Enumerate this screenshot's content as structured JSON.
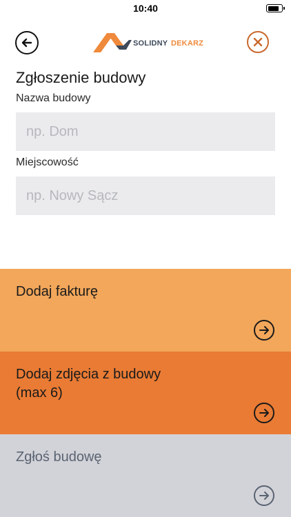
{
  "status_bar": {
    "time": "10:40"
  },
  "header": {
    "logo_text_primary": "SOLIDNY",
    "logo_text_secondary": "DEKARZ",
    "back_icon": "arrow-left-circle-icon",
    "close_icon": "x-circle-icon"
  },
  "form": {
    "title": "Zgłoszenie budowy",
    "fields": [
      {
        "label": "Nazwa budowy",
        "placeholder": "np. Dom",
        "value": ""
      },
      {
        "label": "Miejscowość",
        "placeholder": "np. Nowy Sącz",
        "value": ""
      }
    ]
  },
  "actions": [
    {
      "line1": "Dodaj fakturę",
      "line2": "",
      "color": "#f2a75a",
      "icon": "arrow-right-circle-icon"
    },
    {
      "line1": "Dodaj zdjęcia z budowy",
      "line2": "(max 6)",
      "color": "#e97b34",
      "icon": "arrow-right-circle-icon"
    },
    {
      "line1": "Zgłoś budowę",
      "line2": "",
      "color": "#d2d3d8",
      "icon": "arrow-right-circle-icon"
    }
  ],
  "colors": {
    "accent_light": "#f2a75a",
    "accent": "#e97b34",
    "disabled": "#d2d3d8",
    "close": "#c9672c"
  }
}
